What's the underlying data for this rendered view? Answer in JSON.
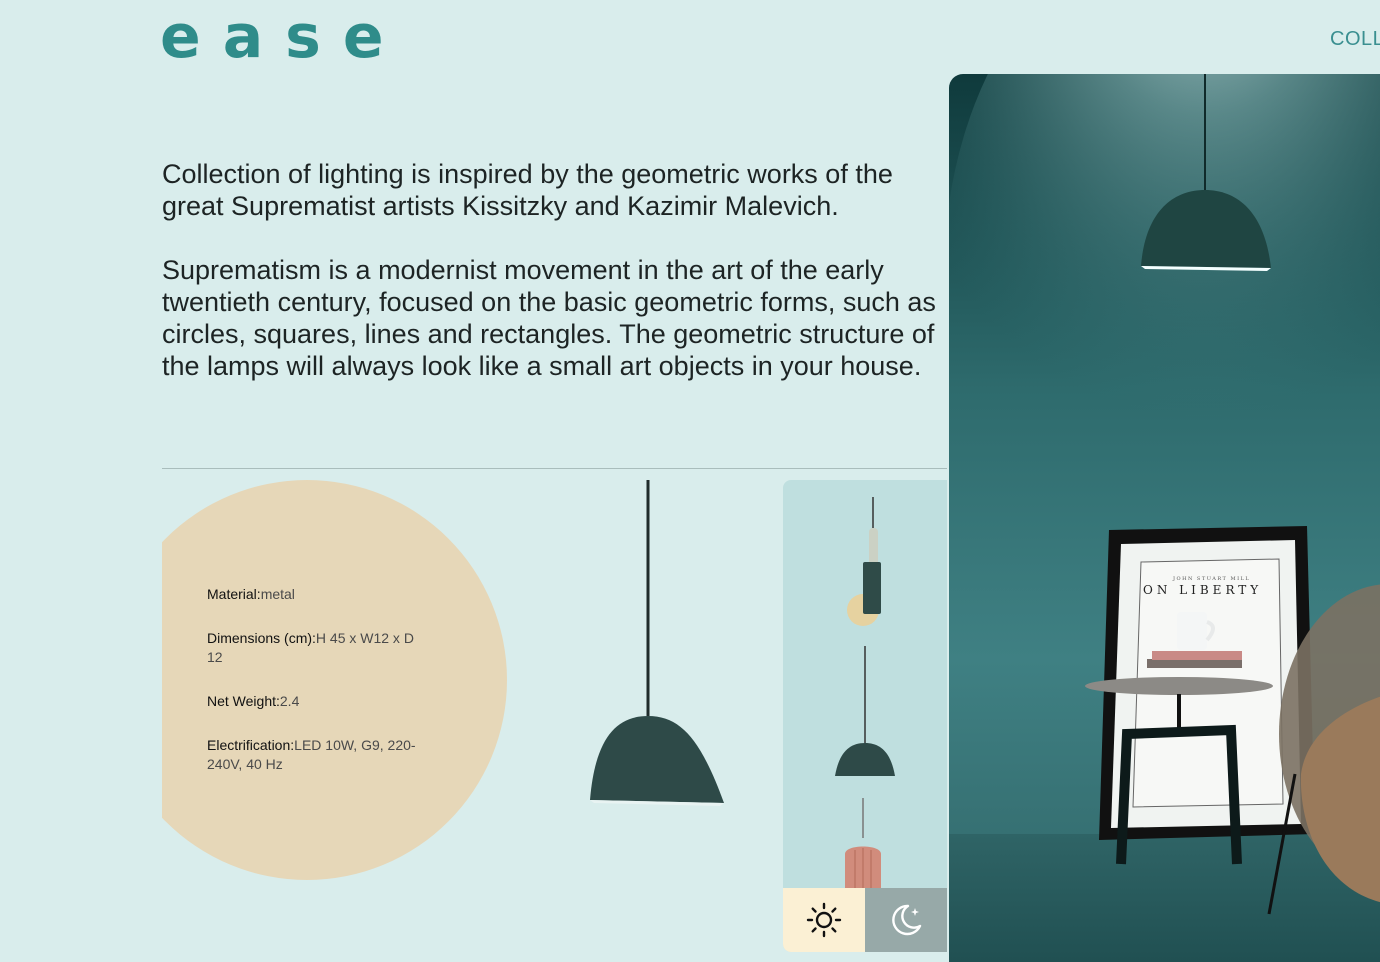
{
  "brand": {
    "logo": "ease"
  },
  "nav": {
    "collections": "COLLECTIONS"
  },
  "intro": {
    "p1": "Collection of lighting is inspired by the geometric works of the great Suprematist artists Kissitzky and Kazimir Malevich.",
    "p2": "Suprematism is a modernist movement in the art of the early twentieth century, focused on the basic geometric forms, such as circles, squares, lines and rectangles. The geometric structure of the lamps will always look like a small art objects in your house."
  },
  "specs": [
    {
      "label": "Material:",
      "value": "metal"
    },
    {
      "label": "Dimensions (cm):",
      "value": "H 45 x W12 x D 12"
    },
    {
      "label": "Net Weight:",
      "value": "2.4"
    },
    {
      "label": "Electrification:",
      "value": "LED 10W, G9, 220-240V, 40 Hz"
    }
  ],
  "mode_toggle": {
    "light_icon": "sun-icon",
    "dark_icon": "moon-icon"
  },
  "photo": {
    "book_title": "ON LIBERTY",
    "book_author": "JOHN STUART MILL"
  },
  "colors": {
    "background": "#d9edec",
    "brand": "#2f8c8a",
    "circle": "#e6d7b8",
    "lamp": "#2e4a48",
    "light_mode": "#fbf0d4",
    "dark_mode": "#97a9a8"
  }
}
